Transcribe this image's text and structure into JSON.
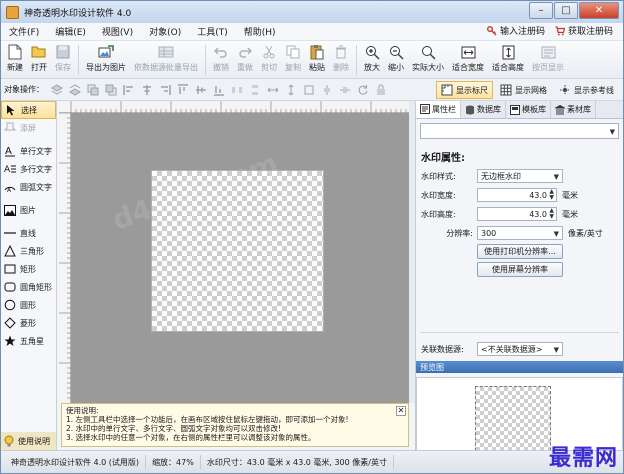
{
  "titlebar": {
    "title": "神奇透明水印设计软件 4.0"
  },
  "menu": {
    "items": [
      "文件(F)",
      "编辑(E)",
      "视图(V)",
      "对象(O)",
      "工具(T)",
      "帮助(H)"
    ],
    "register": "输入注册码",
    "get_code": "获取注册码"
  },
  "toolbar": {
    "new": "新建",
    "open": "打开",
    "save": "保存",
    "export_image": "导出为图片",
    "batch_export": "依数据源批量导出",
    "undo": "撤销",
    "redo": "重做",
    "cut": "剪切",
    "copy": "复制",
    "paste": "粘贴",
    "delete": "删除",
    "zoom_in": "放大",
    "zoom_out": "缩小",
    "actual_size": "实际大小",
    "fit_width": "适合宽度",
    "fit_height": "适合高度",
    "page_show": "按页显示"
  },
  "toolbar2": {
    "label": "对象操作：",
    "show_ruler": "显示标尺",
    "show_grid": "显示网格",
    "show_guides": "显示参考线"
  },
  "tools": [
    {
      "name": "tool-select",
      "label": "选择",
      "selected": true,
      "enabled": true
    },
    {
      "name": "tool-add-layer",
      "label": "添屏",
      "selected": false,
      "enabled": false
    },
    {
      "name": "tool-single-text",
      "label": "单行文字",
      "selected": false,
      "enabled": true
    },
    {
      "name": "tool-multi-text",
      "label": "多行文字",
      "selected": false,
      "enabled": true
    },
    {
      "name": "tool-arc-text",
      "label": "圆弧文字",
      "selected": false,
      "enabled": true
    },
    {
      "name": "tool-image",
      "label": "图片",
      "selected": false,
      "enabled": true
    },
    {
      "name": "tool-line",
      "label": "直线",
      "selected": false,
      "enabled": true
    },
    {
      "name": "tool-triangle",
      "label": "三角形",
      "selected": false,
      "enabled": true
    },
    {
      "name": "tool-rectangle",
      "label": "矩形",
      "selected": false,
      "enabled": true
    },
    {
      "name": "tool-rounded-rect",
      "label": "圆角矩形",
      "selected": false,
      "enabled": true
    },
    {
      "name": "tool-ellipse",
      "label": "圆形",
      "selected": false,
      "enabled": true
    },
    {
      "name": "tool-diamond",
      "label": "菱形",
      "selected": false,
      "enabled": true
    },
    {
      "name": "tool-star",
      "label": "五角星",
      "selected": false,
      "enabled": true
    }
  ],
  "help_button": "使用说明",
  "help_text": {
    "title": "使用说明:",
    "line1": "1. 左侧工具栏中选择一个功能后，在画布区域按住鼠标左键拖动，即可添加一个对象!",
    "line2": "2. 水印中的单行文字、多行文字、圆弧文字对象均可以双击修改!",
    "line3": "3. 选择水印中的任意一个对象，在右侧的属性栏里可以调整该对象的属性。"
  },
  "rightpanel": {
    "tabs": [
      "属性栏",
      "数据库",
      "模板库",
      "素材库"
    ],
    "section_title": "水印属性:",
    "style_label": "水印样式:",
    "style_value": "无边框水印",
    "width_label": "水印宽度:",
    "width_value": "43.0",
    "width_unit": "毫米",
    "height_label": "水印高度:",
    "height_value": "43.0",
    "height_unit": "毫米",
    "dpi_label": "分辨率:",
    "dpi_value": "300",
    "dpi_unit": "像素/英寸",
    "btn_printer_dpi": "使用打印机分辨率...",
    "btn_screen_dpi": "使用屏幕分辨率",
    "datasource_label": "关联数据源:",
    "datasource_value": "<不关联数据源>",
    "preview_title": "预览图"
  },
  "status": {
    "app": "神奇透明水印设计软件 4.0 (试用版)",
    "zoom": "缩放：47%",
    "size": "水印尺寸：43.0 毫米 x 43.0 毫米, 300 像素/英寸"
  },
  "logo": "最需网",
  "canvas_watermark": "d4000.com"
}
